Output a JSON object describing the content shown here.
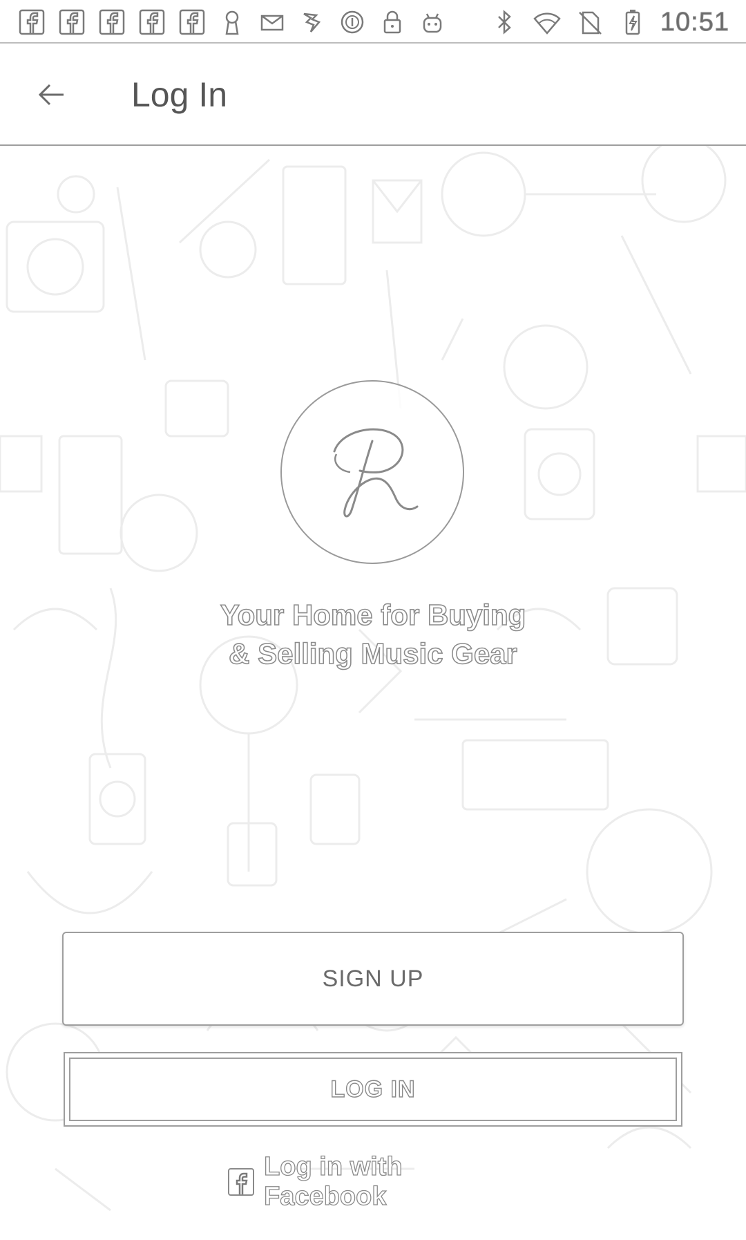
{
  "status_bar": {
    "time": "10:51",
    "left_icons": [
      "facebook-icon",
      "facebook-icon",
      "facebook-icon",
      "facebook-icon",
      "facebook-icon",
      "keyhole-icon",
      "mail-icon",
      "fm-app-icon",
      "circle-one-icon",
      "lock-icon",
      "android-icon"
    ],
    "right_icons": [
      "bluetooth-icon",
      "wifi-icon",
      "no-sim-icon",
      "battery-charging-icon"
    ]
  },
  "app_bar": {
    "title": "Log In",
    "back_icon": "arrow-left-icon"
  },
  "hero": {
    "logo_letter": "R",
    "tagline_line1": "Your Home for Buying",
    "tagline_line2": "& Selling Music Gear"
  },
  "actions": {
    "signup_label": "SIGN UP",
    "login_label": "LOG IN",
    "facebook_label": "Log in with Facebook",
    "facebook_icon": "facebook-icon"
  },
  "colors": {
    "background": "#ffffff",
    "outline": "#9e9e9e",
    "text": "#5a5a5a"
  }
}
